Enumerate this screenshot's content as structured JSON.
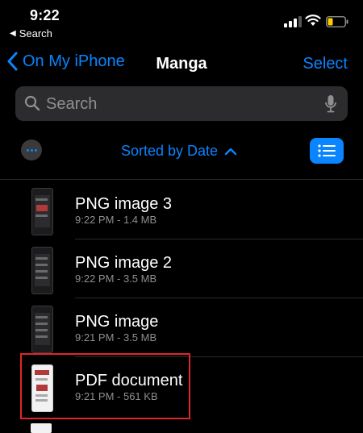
{
  "status": {
    "time": "9:22",
    "back_app": "Search"
  },
  "nav": {
    "back_label": "On My iPhone",
    "title": "Manga",
    "select_label": "Select"
  },
  "search": {
    "placeholder": "Search",
    "value": ""
  },
  "toolbar": {
    "sort_label": "Sorted by Date"
  },
  "files": [
    {
      "name": "PNG image 3",
      "meta": "9:22 PM - 1.4 MB",
      "thumb": "dark-screenshot"
    },
    {
      "name": "PNG image 2",
      "meta": "9:22 PM - 3.5 MB",
      "thumb": "dark-screenshot"
    },
    {
      "name": "PNG image",
      "meta": "9:21 PM - 3.5 MB",
      "thumb": "dark-screenshot"
    },
    {
      "name": "PDF document",
      "meta": "9:21 PM - 561 KB",
      "thumb": "light-document"
    }
  ],
  "colors": {
    "accent": "#0a84ff",
    "background": "#000000",
    "highlight": "#e0242b",
    "secondary_text": "#8e8e93"
  }
}
